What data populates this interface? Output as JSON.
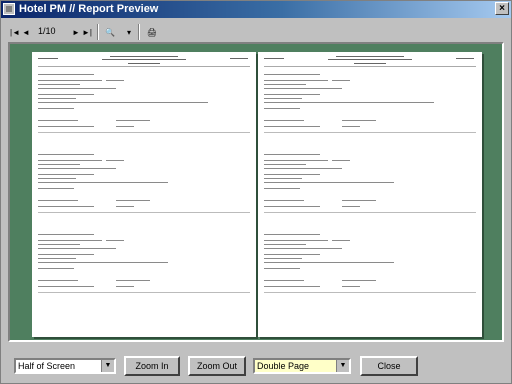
{
  "window": {
    "title": "Hotel PM // Report Preview",
    "close_label": "×"
  },
  "toolbar": {
    "first_label": "|◄",
    "prev_label": "◄",
    "page_indicator": "1/10",
    "next_label": "►",
    "last_label": "►|",
    "zoom_label": "🔍",
    "zoom_dropdown_label": "▾",
    "print_label": "🖨"
  },
  "bottom": {
    "zoom_select_value": "Half of Screen",
    "zoom_in_label": "Zoom In",
    "zoom_out_label": "Zoom Out",
    "page_mode_value": "Double Page",
    "close_label": "Close"
  }
}
